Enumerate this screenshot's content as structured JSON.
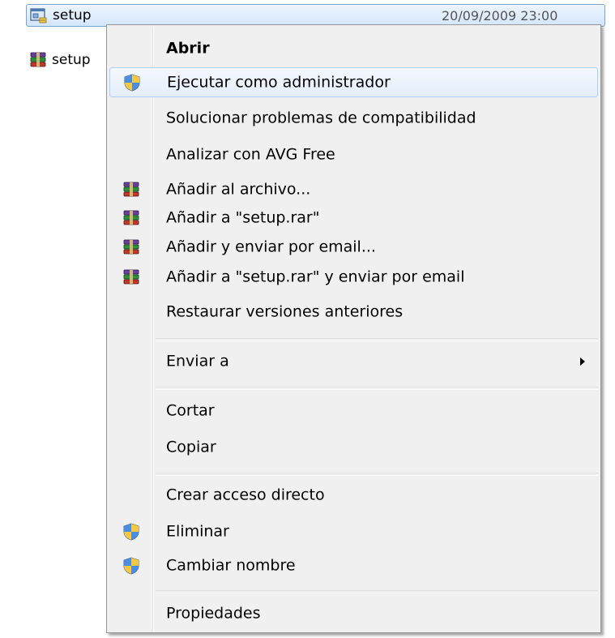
{
  "files": [
    {
      "name": "setup",
      "date": "20/09/2009 23:00",
      "icon": "setup-installer-icon",
      "selected": true
    },
    {
      "name": "setup",
      "icon": "winrar-archive-icon",
      "selected": false
    }
  ],
  "menu": {
    "items": [
      {
        "label": "Abrir",
        "bold": true,
        "icon": null
      },
      {
        "label": "Ejecutar como administrador",
        "icon": "uac-shield-icon",
        "hover": true
      },
      {
        "label": "Solucionar problemas de compatibilidad",
        "icon": null
      },
      {
        "label": "Analizar con AVG Free",
        "icon": null
      },
      {
        "label": "Añadir al archivo...",
        "icon": "winrar-icon"
      },
      {
        "label": "Añadir a \"setup.rar\"",
        "icon": "winrar-icon"
      },
      {
        "label": "Añadir y enviar por email...",
        "icon": "winrar-icon"
      },
      {
        "label": "Añadir a \"setup.rar\" y enviar por email",
        "icon": "winrar-icon"
      },
      {
        "label": "Restaurar versiones anteriores",
        "icon": null
      },
      {
        "label": "Enviar a",
        "icon": null,
        "submenu": true
      },
      {
        "label": "Cortar",
        "icon": null
      },
      {
        "label": "Copiar",
        "icon": null
      },
      {
        "label": "Crear acceso directo",
        "icon": null
      },
      {
        "label": "Eliminar",
        "icon": "uac-shield-icon"
      },
      {
        "label": "Cambiar nombre",
        "icon": "uac-shield-icon"
      },
      {
        "label": "Propiedades",
        "icon": null
      }
    ]
  },
  "colors": {
    "menu_bg": "#f0f0f0",
    "hover_border": "#aecff7",
    "selection_border": "#7da2ce"
  }
}
